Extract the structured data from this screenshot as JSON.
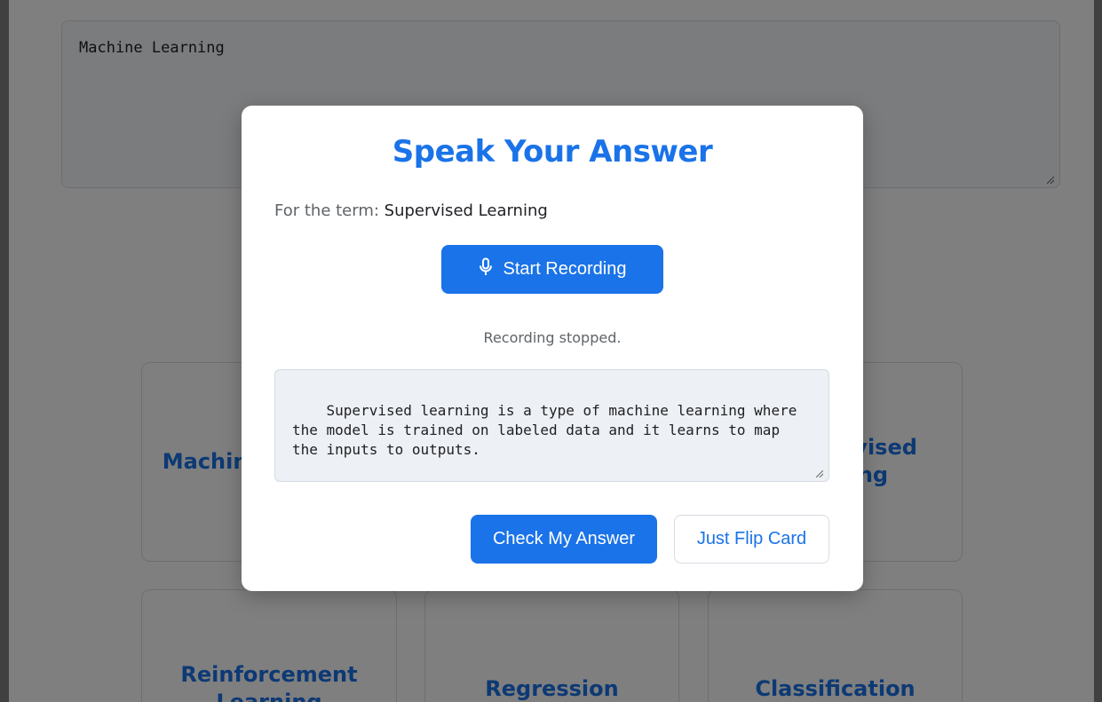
{
  "background": {
    "topic_input_value": "Machine Learning",
    "cards": [
      {
        "label_line1": "Machine Learning",
        "label_line2": ""
      },
      {
        "label_line1": "Unsupervised",
        "label_line2": "Learning"
      },
      {
        "label_line1": "Reinforcement",
        "label_line2": "Learning"
      },
      {
        "label_line1": "Regression",
        "label_line2": ""
      },
      {
        "label_line1": "Classification",
        "label_line2": ""
      }
    ]
  },
  "modal": {
    "title": "Speak Your Answer",
    "term_prefix": "For the term:",
    "term": "Supervised Learning",
    "record_button": "Start Recording",
    "status": "Recording stopped.",
    "answer": "Supervised learning is a type of machine learning where the model is trained on labeled data and it learns to map the inputs to outputs.",
    "check_button": "Check My Answer",
    "flip_button": "Just Flip Card"
  },
  "colors": {
    "accent": "#1a73e8",
    "overlay": "rgba(0,0,0,0.5)"
  },
  "icons": {
    "record": "microphone-icon"
  }
}
